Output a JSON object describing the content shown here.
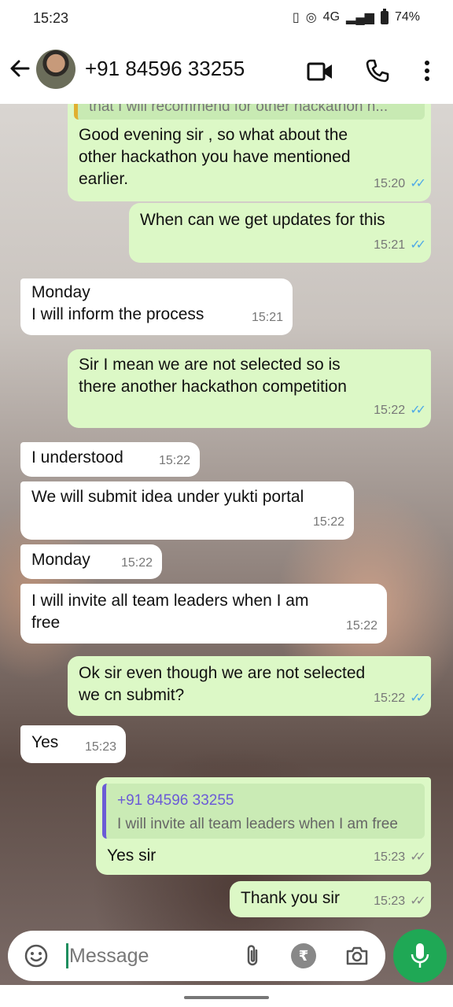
{
  "status": {
    "time": "15:23",
    "network": "4G",
    "battery": "74%"
  },
  "header": {
    "contact_name": "+91 84596 33255"
  },
  "messages": [
    {
      "type": "sent",
      "quote_fragment": "that I will recommend for other hackathon n...",
      "text_lines": [
        "Good evening sir , so what about the",
        "other hackathon you have mentioned",
        "earlier."
      ],
      "time": "15:20"
    },
    {
      "type": "sent",
      "text_lines": [
        "When can we get updates for this"
      ],
      "time": "15:21"
    },
    {
      "type": "recv",
      "text_lines": [
        "Monday",
        "I will inform the process"
      ],
      "time": "15:21"
    },
    {
      "type": "sent",
      "text_lines": [
        "Sir I mean we are not selected so is",
        "there another hackathon competition"
      ],
      "time": "15:22"
    },
    {
      "type": "recv",
      "text_lines": [
        "I understood"
      ],
      "time": "15:22"
    },
    {
      "type": "recv",
      "text_lines": [
        "We will submit idea under yukti portal"
      ],
      "time": "15:22"
    },
    {
      "type": "recv",
      "text_lines": [
        "Monday"
      ],
      "time": "15:22"
    },
    {
      "type": "recv",
      "text_lines": [
        "I will invite all team leaders when I am",
        "free"
      ],
      "time": "15:22"
    },
    {
      "type": "sent",
      "text_lines": [
        "Ok sir even though we are not selected",
        "we cn submit?"
      ],
      "time": "15:22"
    },
    {
      "type": "recv",
      "text_lines": [
        "Yes"
      ],
      "time": "15:23"
    },
    {
      "type": "sent",
      "reply_to": {
        "name": "+91 84596 33255",
        "text": "I will invite all team leaders when I am free"
      },
      "text_lines": [
        "Yes sir"
      ],
      "time": "15:23"
    },
    {
      "type": "sent",
      "text_lines": [
        "Thank you sir"
      ],
      "time": "15:23"
    }
  ],
  "input": {
    "placeholder": "Message"
  },
  "icons": {
    "rupee": "₹"
  }
}
